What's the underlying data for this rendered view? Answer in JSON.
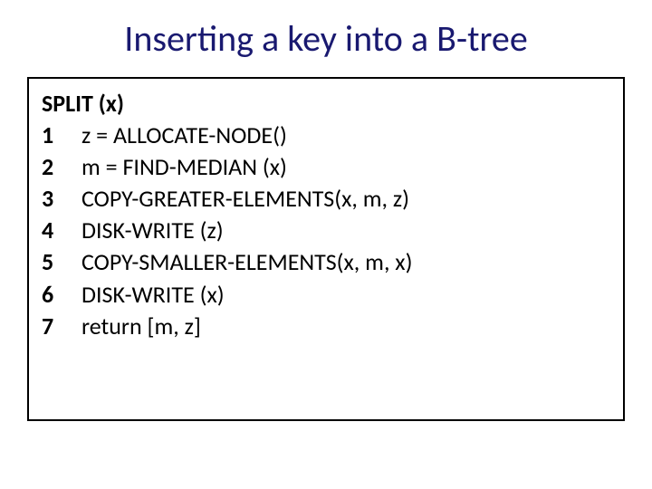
{
  "title": "Inserting a key into a B-tree",
  "pseudocode": {
    "function_header": "SPLIT (x)",
    "lines": [
      {
        "num": "1",
        "code": "z = ALLOCATE-NODE()"
      },
      {
        "num": "2",
        "code": "m = FIND-MEDIAN (x)"
      },
      {
        "num": "3",
        "code": "COPY-GREATER-ELEMENTS(x, m, z)"
      },
      {
        "num": "4",
        "code": "DISK-WRITE (z)"
      },
      {
        "num": "5",
        "code": "COPY-SMALLER-ELEMENTS(x, m, x)"
      },
      {
        "num": "6",
        "code": "DISK-WRITE (x)"
      },
      {
        "num": "7",
        "code": "return [m, z]"
      }
    ]
  }
}
